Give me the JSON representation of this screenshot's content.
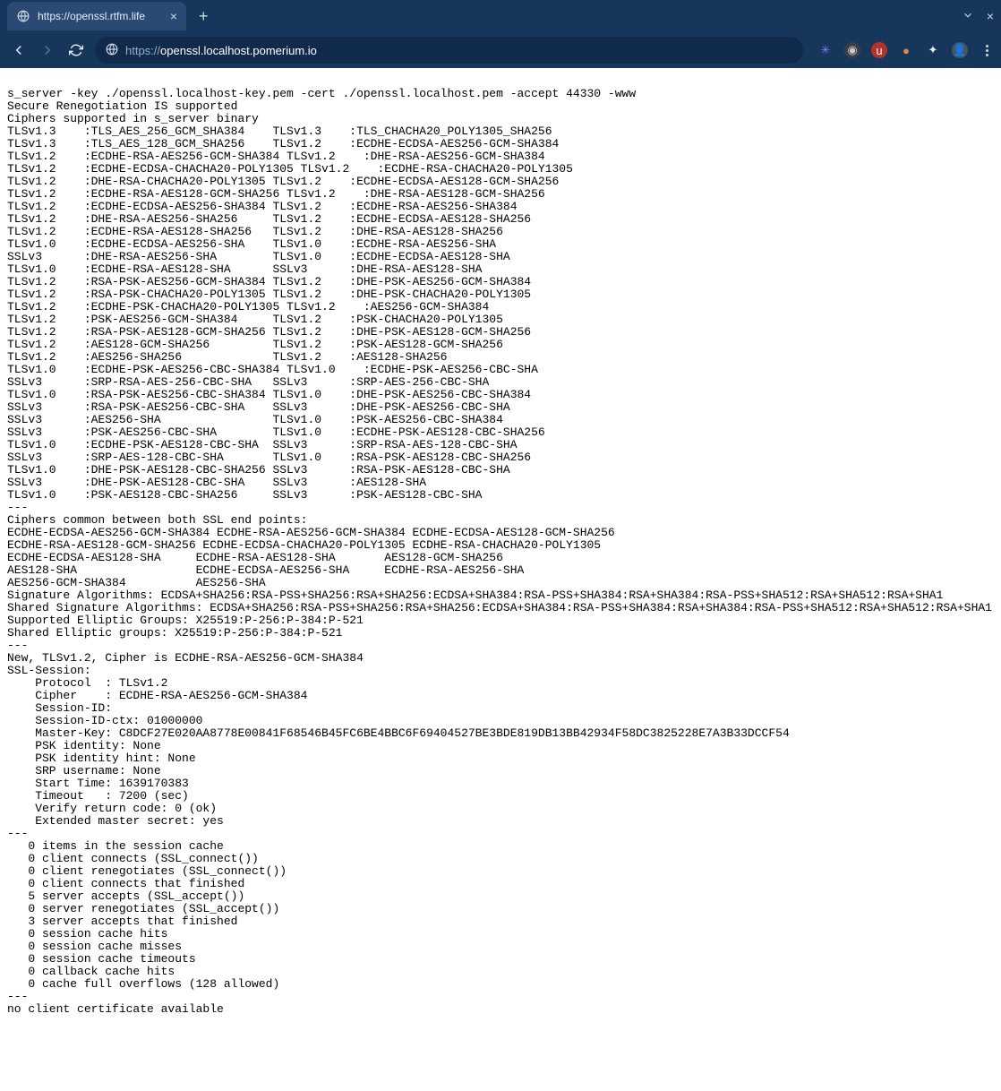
{
  "browser": {
    "tab": {
      "title": "https://openssl.rtfm.life"
    },
    "url": {
      "scheme": "https://",
      "host": "openssl.localhost.pomerium.io",
      "path": ""
    },
    "extensions": [
      {
        "name": "starburst",
        "bg": "transparent",
        "fg": "#8a7dff",
        "glyph": "✳"
      },
      {
        "name": "camera",
        "bg": "#3a3f47",
        "fg": "#c8ccd0",
        "glyph": "◉"
      },
      {
        "name": "ublock",
        "bg": "#b63129",
        "fg": "#ffffff",
        "glyph": "u"
      },
      {
        "name": "pill",
        "bg": "transparent",
        "fg": "#e08a3a",
        "glyph": "●"
      },
      {
        "name": "puzzle",
        "bg": "transparent",
        "fg": "#e8eef5",
        "glyph": "✦"
      },
      {
        "name": "avatar",
        "bg": "#4a5560",
        "fg": "#e8eef5",
        "glyph": "👤"
      }
    ]
  },
  "page": {
    "body": "s_server -key ./openssl.localhost-key.pem -cert ./openssl.localhost.pem -accept 44330 -www\nSecure Renegotiation IS supported\nCiphers supported in s_server binary\nTLSv1.3    :TLS_AES_256_GCM_SHA384    TLSv1.3    :TLS_CHACHA20_POLY1305_SHA256\nTLSv1.3    :TLS_AES_128_GCM_SHA256    TLSv1.2    :ECDHE-ECDSA-AES256-GCM-SHA384\nTLSv1.2    :ECDHE-RSA-AES256-GCM-SHA384 TLSv1.2    :DHE-RSA-AES256-GCM-SHA384\nTLSv1.2    :ECDHE-ECDSA-CHACHA20-POLY1305 TLSv1.2    :ECDHE-RSA-CHACHA20-POLY1305\nTLSv1.2    :DHE-RSA-CHACHA20-POLY1305 TLSv1.2    :ECDHE-ECDSA-AES128-GCM-SHA256\nTLSv1.2    :ECDHE-RSA-AES128-GCM-SHA256 TLSv1.2    :DHE-RSA-AES128-GCM-SHA256\nTLSv1.2    :ECDHE-ECDSA-AES256-SHA384 TLSv1.2    :ECDHE-RSA-AES256-SHA384\nTLSv1.2    :DHE-RSA-AES256-SHA256     TLSv1.2    :ECDHE-ECDSA-AES128-SHA256\nTLSv1.2    :ECDHE-RSA-AES128-SHA256   TLSv1.2    :DHE-RSA-AES128-SHA256\nTLSv1.0    :ECDHE-ECDSA-AES256-SHA    TLSv1.0    :ECDHE-RSA-AES256-SHA\nSSLv3      :DHE-RSA-AES256-SHA        TLSv1.0    :ECDHE-ECDSA-AES128-SHA\nTLSv1.0    :ECDHE-RSA-AES128-SHA      SSLv3      :DHE-RSA-AES128-SHA\nTLSv1.2    :RSA-PSK-AES256-GCM-SHA384 TLSv1.2    :DHE-PSK-AES256-GCM-SHA384\nTLSv1.2    :RSA-PSK-CHACHA20-POLY1305 TLSv1.2    :DHE-PSK-CHACHA20-POLY1305\nTLSv1.2    :ECDHE-PSK-CHACHA20-POLY1305 TLSv1.2    :AES256-GCM-SHA384\nTLSv1.2    :PSK-AES256-GCM-SHA384     TLSv1.2    :PSK-CHACHA20-POLY1305\nTLSv1.2    :RSA-PSK-AES128-GCM-SHA256 TLSv1.2    :DHE-PSK-AES128-GCM-SHA256\nTLSv1.2    :AES128-GCM-SHA256         TLSv1.2    :PSK-AES128-GCM-SHA256\nTLSv1.2    :AES256-SHA256             TLSv1.2    :AES128-SHA256\nTLSv1.0    :ECDHE-PSK-AES256-CBC-SHA384 TLSv1.0    :ECDHE-PSK-AES256-CBC-SHA\nSSLv3      :SRP-RSA-AES-256-CBC-SHA   SSLv3      :SRP-AES-256-CBC-SHA\nTLSv1.0    :RSA-PSK-AES256-CBC-SHA384 TLSv1.0    :DHE-PSK-AES256-CBC-SHA384\nSSLv3      :RSA-PSK-AES256-CBC-SHA    SSLv3      :DHE-PSK-AES256-CBC-SHA\nSSLv3      :AES256-SHA                TLSv1.0    :PSK-AES256-CBC-SHA384\nSSLv3      :PSK-AES256-CBC-SHA        TLSv1.0    :ECDHE-PSK-AES128-CBC-SHA256\nTLSv1.0    :ECDHE-PSK-AES128-CBC-SHA  SSLv3      :SRP-RSA-AES-128-CBC-SHA\nSSLv3      :SRP-AES-128-CBC-SHA       TLSv1.0    :RSA-PSK-AES128-CBC-SHA256\nTLSv1.0    :DHE-PSK-AES128-CBC-SHA256 SSLv3      :RSA-PSK-AES128-CBC-SHA\nSSLv3      :DHE-PSK-AES128-CBC-SHA    SSLv3      :AES128-SHA\nTLSv1.0    :PSK-AES128-CBC-SHA256     SSLv3      :PSK-AES128-CBC-SHA\n---\nCiphers common between both SSL end points:\nECDHE-ECDSA-AES256-GCM-SHA384 ECDHE-RSA-AES256-GCM-SHA384 ECDHE-ECDSA-AES128-GCM-SHA256\nECDHE-RSA-AES128-GCM-SHA256 ECDHE-ECDSA-CHACHA20-POLY1305 ECDHE-RSA-CHACHA20-POLY1305\nECDHE-ECDSA-AES128-SHA     ECDHE-RSA-AES128-SHA       AES128-GCM-SHA256\nAES128-SHA                 ECDHE-ECDSA-AES256-SHA     ECDHE-RSA-AES256-SHA\nAES256-GCM-SHA384          AES256-SHA\nSignature Algorithms: ECDSA+SHA256:RSA-PSS+SHA256:RSA+SHA256:ECDSA+SHA384:RSA-PSS+SHA384:RSA+SHA384:RSA-PSS+SHA512:RSA+SHA512:RSA+SHA1\nShared Signature Algorithms: ECDSA+SHA256:RSA-PSS+SHA256:RSA+SHA256:ECDSA+SHA384:RSA-PSS+SHA384:RSA+SHA384:RSA-PSS+SHA512:RSA+SHA512:RSA+SHA1\nSupported Elliptic Groups: X25519:P-256:P-384:P-521\nShared Elliptic groups: X25519:P-256:P-384:P-521\n---\nNew, TLSv1.2, Cipher is ECDHE-RSA-AES256-GCM-SHA384\nSSL-Session:\n    Protocol  : TLSv1.2\n    Cipher    : ECDHE-RSA-AES256-GCM-SHA384\n    Session-ID:\n    Session-ID-ctx: 01000000\n    Master-Key: C8DCF27E020AA8778E00841F68546B45FC6BE4BBC6F69404527BE3BDE819DB13BB42934F58DC3825228E7A3B33DCCF54\n    PSK identity: None\n    PSK identity hint: None\n    SRP username: None\n    Start Time: 1639170383\n    Timeout   : 7200 (sec)\n    Verify return code: 0 (ok)\n    Extended master secret: yes\n---\n   0 items in the session cache\n   0 client connects (SSL_connect())\n   0 client renegotiates (SSL_connect())\n   0 client connects that finished\n   5 server accepts (SSL_accept())\n   0 server renegotiates (SSL_accept())\n   3 server accepts that finished\n   0 session cache hits\n   0 session cache misses\n   0 session cache timeouts\n   0 callback cache hits\n   0 cache full overflows (128 allowed)\n---\nno client certificate available"
  }
}
